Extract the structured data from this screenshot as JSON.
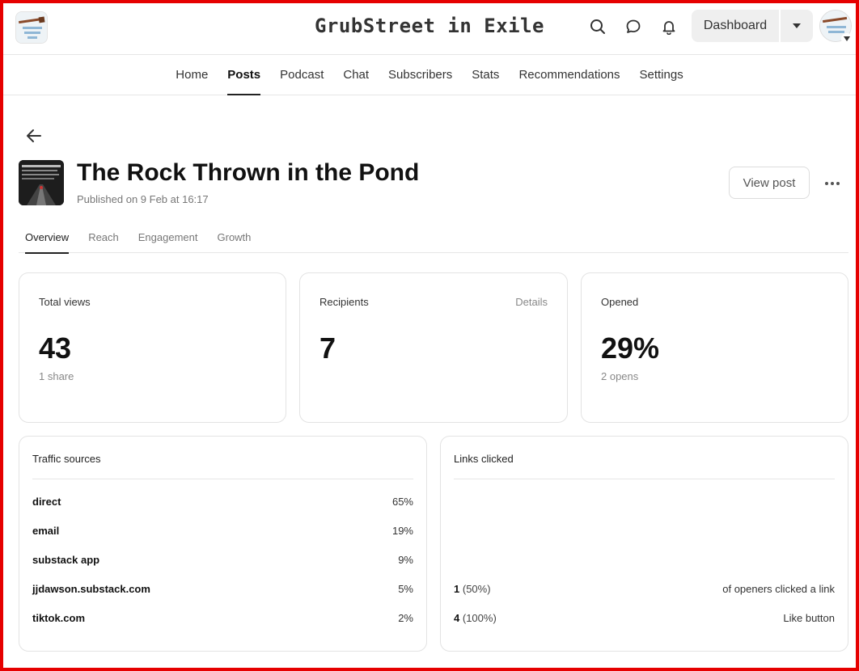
{
  "site": {
    "title": "GrubStreet in Exile",
    "dashboard_label": "Dashboard"
  },
  "nav": {
    "items": [
      "Home",
      "Posts",
      "Podcast",
      "Chat",
      "Subscribers",
      "Stats",
      "Recommendations",
      "Settings"
    ],
    "active": "Posts"
  },
  "post": {
    "title": "The Rock Thrown in the Pond",
    "published": "Published on 9 Feb at 16:17",
    "view_label": "View post"
  },
  "tabs": {
    "items": [
      "Overview",
      "Reach",
      "Engagement",
      "Growth"
    ],
    "active": "Overview"
  },
  "stats": [
    {
      "label": "Total views",
      "value": "43",
      "sub": "1 share",
      "details": ""
    },
    {
      "label": "Recipients",
      "value": "7",
      "sub": "",
      "details": "Details"
    },
    {
      "label": "Opened",
      "value": "29%",
      "sub": "2 opens",
      "details": ""
    }
  ],
  "traffic": {
    "title": "Traffic sources",
    "rows": [
      {
        "name": "direct",
        "pct": "65%"
      },
      {
        "name": "email",
        "pct": "19%"
      },
      {
        "name": "substack app",
        "pct": "9%"
      },
      {
        "name": "jjdawson.substack.com",
        "pct": "5%"
      },
      {
        "name": "tiktok.com",
        "pct": "2%"
      }
    ]
  },
  "links": {
    "title": "Links clicked",
    "rows": [
      {
        "count": "1",
        "pct": "(50%)",
        "desc": "of openers clicked a link"
      },
      {
        "count": "4",
        "pct": "(100%)",
        "desc": "Like button"
      }
    ]
  },
  "icons": {
    "search": "search-icon",
    "chat": "chat-bubble-icon",
    "bell": "bell-icon",
    "caret": "caret-down-icon",
    "back": "arrow-left-icon",
    "more": "more-horizontal-icon"
  },
  "colors": {
    "frame": "#e60000",
    "accent_text": "#111111",
    "muted_text": "#777777",
    "button_bg": "#efefef"
  }
}
